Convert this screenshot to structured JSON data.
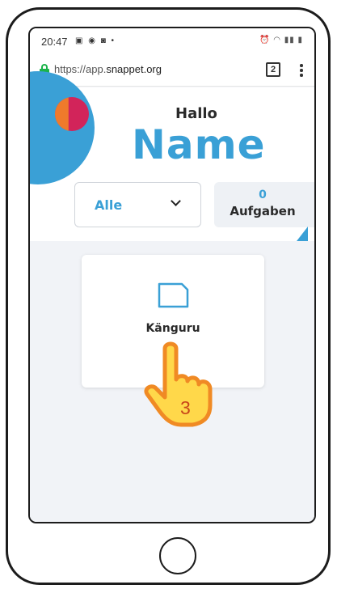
{
  "status_bar": {
    "time": "20:47",
    "left_icons": "▣ ◉ ◙ •",
    "right_icons": "⏰ ◠ ▮▮ ▮"
  },
  "browser": {
    "url_prefix": "https://app.",
    "url_domain": "snappet.org",
    "tab_count": "2",
    "lock_color": "#1bb34a"
  },
  "header": {
    "greeting": "Hallo",
    "name": "Name",
    "filter": {
      "selected": "Alle"
    },
    "tasks": {
      "count": "0",
      "label": "Aufgaben"
    }
  },
  "cards": [
    {
      "title": "Känguru",
      "icon": "document-icon"
    }
  ],
  "overlay": {
    "hand_icon": "pointing-hand-icon",
    "step_number": "3"
  },
  "colors": {
    "accent_blue": "#3aa0d6",
    "accent_red": "#d2245a",
    "accent_orange": "#ef7a2b",
    "hand_yellow": "#ffd84a",
    "hand_outline": "#f08a24"
  }
}
